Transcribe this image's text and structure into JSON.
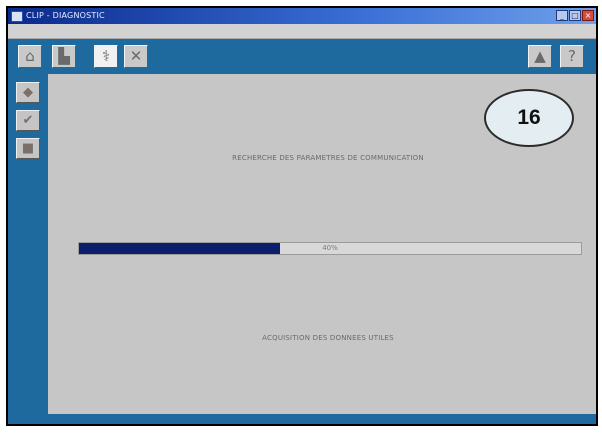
{
  "window": {
    "title": "CLIP - DIAGNOSTIC",
    "minimize_glyph": "_",
    "maximize_glyph": "□",
    "close_glyph": "×"
  },
  "menubar": {
    "text": ""
  },
  "toolbar": {
    "buttons": [
      {
        "name": "home-icon",
        "glyph": "⌂"
      },
      {
        "name": "vehicle-identification-icon",
        "glyph": "▙"
      },
      {
        "name": "diagnostic-test-icon",
        "glyph": "⚕"
      },
      {
        "name": "tools-icon",
        "glyph": "✕"
      },
      {
        "name": "print-icon",
        "glyph": "▲"
      },
      {
        "name": "help-icon",
        "glyph": "?"
      }
    ]
  },
  "sidebar": {
    "buttons": [
      {
        "name": "settings-icon",
        "glyph": "◆"
      },
      {
        "name": "checklist-icon",
        "glyph": "✔"
      },
      {
        "name": "notebook-icon",
        "glyph": "■"
      }
    ]
  },
  "main": {
    "step_number": "16",
    "heading": "RECHERCHE DES PARAMETRES DE COMMUNICATION",
    "progress": {
      "value_percent": 40,
      "label": "40%"
    },
    "status_text": "ACQUISITION DES DONNEES UTILES"
  }
}
